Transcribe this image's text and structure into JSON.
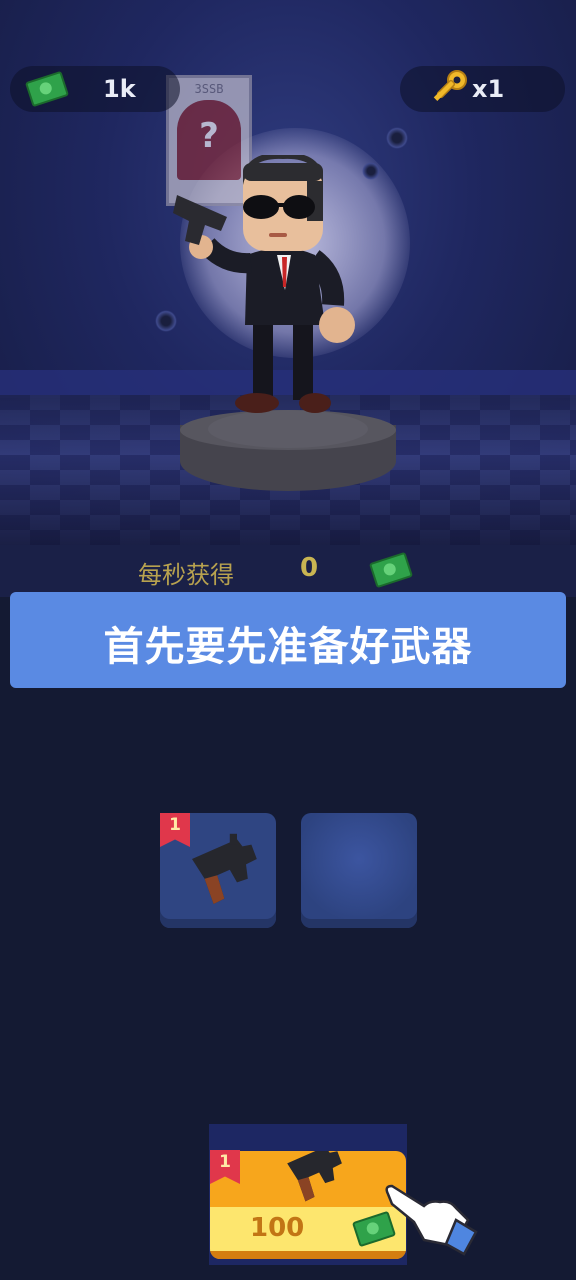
{
  "hud": {
    "money": "1k",
    "keys": "x1"
  },
  "poster": {
    "code": "3SSB",
    "mark": "?"
  },
  "income": {
    "label": "每秒获得",
    "value": "0"
  },
  "banner": {
    "text": "首先要先准备好武器"
  },
  "slots": [
    {
      "level": "1",
      "item": "pistol-icon"
    },
    {
      "level": "",
      "item": ""
    }
  ],
  "buy": {
    "level": "1",
    "price": "100",
    "item": "pistol-icon"
  },
  "colors": {
    "banner": "#5a8ae3",
    "buy_button": "#f7a61c",
    "level_flag": "#e0374b",
    "cash": "#2fa24a"
  }
}
